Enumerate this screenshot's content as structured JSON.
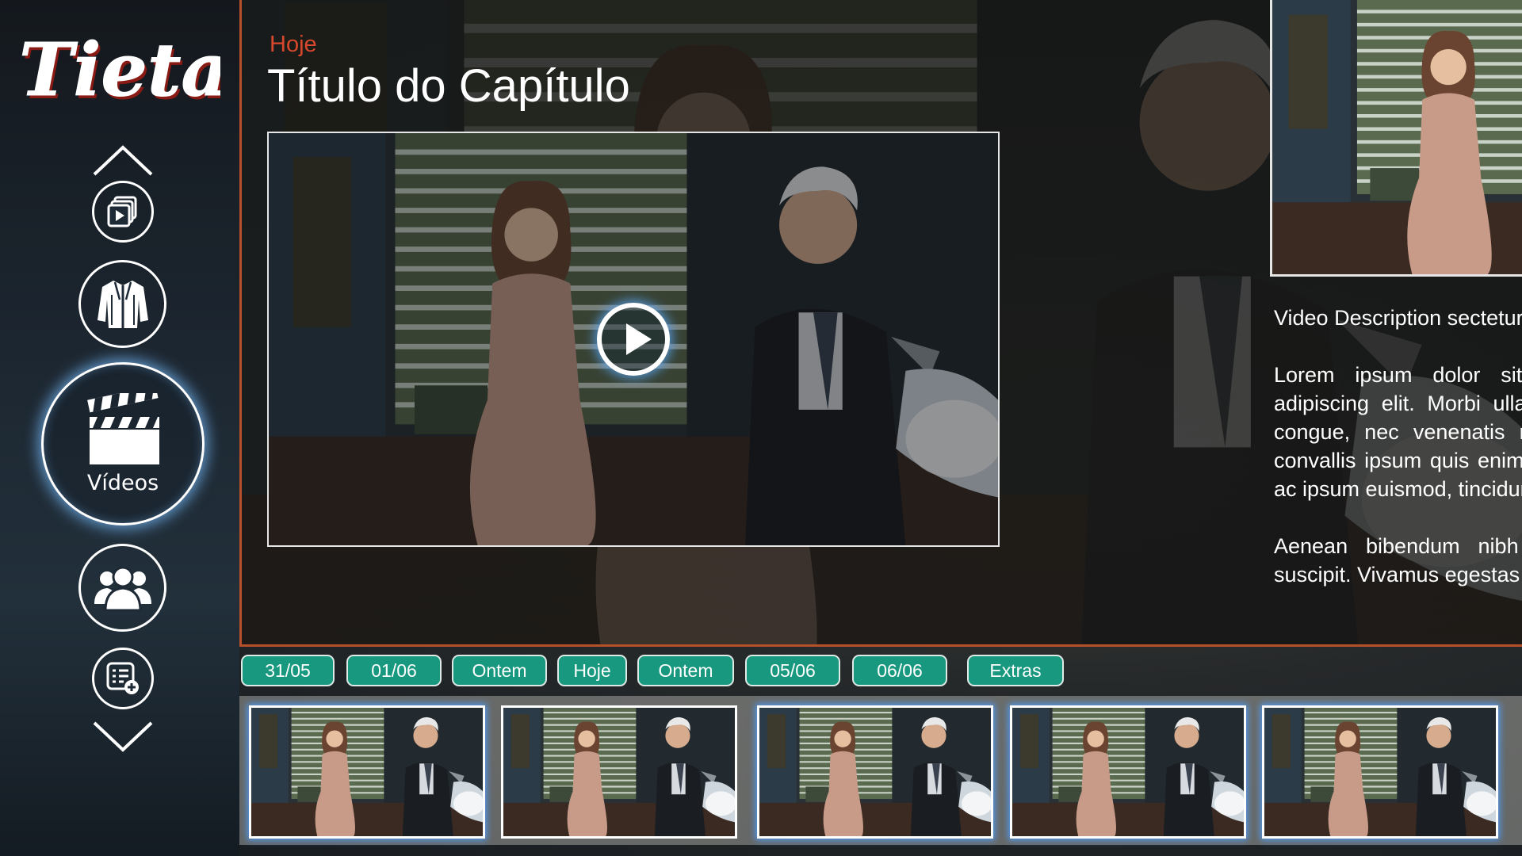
{
  "brand": {
    "logo_text": "Tieta"
  },
  "sidebar": {
    "items": [
      {
        "id": "up",
        "icon": "chevron-up-icon"
      },
      {
        "id": "playlist",
        "icon": "video-playlist-icon"
      },
      {
        "id": "wardrobe",
        "icon": "jacket-icon"
      },
      {
        "id": "videos",
        "icon": "clapperboard-icon",
        "label": "Vídeos",
        "active": true
      },
      {
        "id": "cast",
        "icon": "people-icon"
      },
      {
        "id": "add-list",
        "icon": "add-list-icon"
      },
      {
        "id": "down",
        "icon": "chevron-down-icon"
      }
    ]
  },
  "header": {
    "eyebrow": "Hoje",
    "title": "Título do Capítulo"
  },
  "player": {
    "play_icon": "play-icon"
  },
  "description": {
    "paragraphs": [
      "Video Description sectetur adipiscing elit.",
      "Lorem ipsum dolor sit amet, con sectetur adipiscing elit. Morbi ullamcorper leo a magna congue, nec venenatis magna rutrum. Nullam convallis ipsum quis enim semper interdum. Sed ac ipsum euismod, tincidunt odio ut, gravida est.",
      "Aenean bibendum nibh ut diam consectetur suscipit. Vivamus egestas est"
    ]
  },
  "date_tabs": [
    "31/05",
    "01/06",
    "Ontem",
    "Hoje",
    "Ontem",
    "05/06",
    "06/06",
    "Extras"
  ],
  "thumbnails_count": 5,
  "colors": {
    "accent": "#d8482c",
    "tab_bg": "#18987e",
    "glow": "#78beff"
  }
}
